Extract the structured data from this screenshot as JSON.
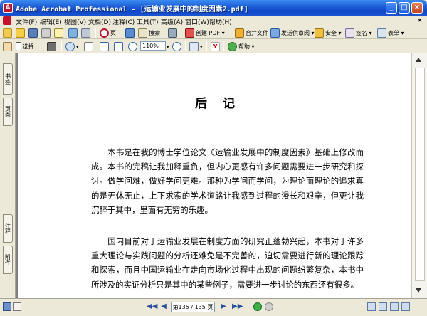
{
  "window": {
    "title": "Adobe Acrobat Professional - [运输业发展中的制度因素2.pdf]",
    "app_icon": "A",
    "buttons": [
      "_",
      "□",
      "×"
    ]
  },
  "menubar": {
    "items": [
      "文件(F)",
      "编辑(E)",
      "视图(V)",
      "文档(D)",
      "注释(C)",
      "工具(T)",
      "高级(A)",
      "窗口(W)",
      "帮助(H)"
    ],
    "close_x": "×"
  },
  "toolbar1": {
    "pages_label": "页",
    "search_label": "搜索",
    "create_pdf": "创建 PDF ▾",
    "combine_files": "合并文件 ▾",
    "send_review": "发送供审阅 ▾",
    "secure": "安全 ▾",
    "sign": "签名 ▾",
    "forms": "表单 ▾"
  },
  "toolbar2": {
    "select_label": "选择",
    "zoom": "110%",
    "help_label": "帮助 ▾"
  },
  "sidepanel": {
    "tab_bookmarks": "书签",
    "tab_pages": "页面",
    "tab_comments": "注释",
    "tab_attachments": "附件"
  },
  "document": {
    "title": "后记",
    "paragraph1": "　　本书是在我的博士学位论文《运输业发展中的制度因素》基础上修改而成。本书的完稿让我加释重负，但内心更感有许多问题需要进一步研究和探讨。做学问难，做好学问更难。那种为学问而学问，为理论而理论的追求真的是无休无止，上下求索的学术道路让我感到过程的漫长和艰辛，但更让我沉醉于其中，里面有无穷的乐趣。",
    "paragraph2": "　　国内目前对于运输业发展在制度方面的研究正蓬勃兴起，本书对于许多重大理论与实践问题的分析还难免是不完善的，迫切需要进行新的理论跟踪和探索，而且中国运输业在走向市场化过程中出现的问题纷繁复杂，本书中所涉及的实证分析只是其中的某些例子，需要进一步讨论的东西还有很多。"
  },
  "statusbar": {
    "page_indicator": "第135 / 135 页",
    "nav_first": "◀◀",
    "nav_prev": "◀",
    "nav_next": "▶",
    "nav_last": "▶▶"
  },
  "icons": [
    "create-pdf-icon",
    "open-icon",
    "save-icon",
    "print-icon",
    "email-icon",
    "search-icon",
    "hand-icon",
    "select-icon",
    "snapshot-icon",
    "zoom-icon",
    "fit-page-icon",
    "fit-width-icon",
    "zoom-out-icon",
    "zoom-in-icon",
    "rotate-icon",
    "yahoo-icon",
    "help-icon"
  ],
  "colors": {
    "titlebar": "#1f5fd8",
    "pdf_red": "#c8102e",
    "toolbar_bg": "#ece9d8"
  }
}
